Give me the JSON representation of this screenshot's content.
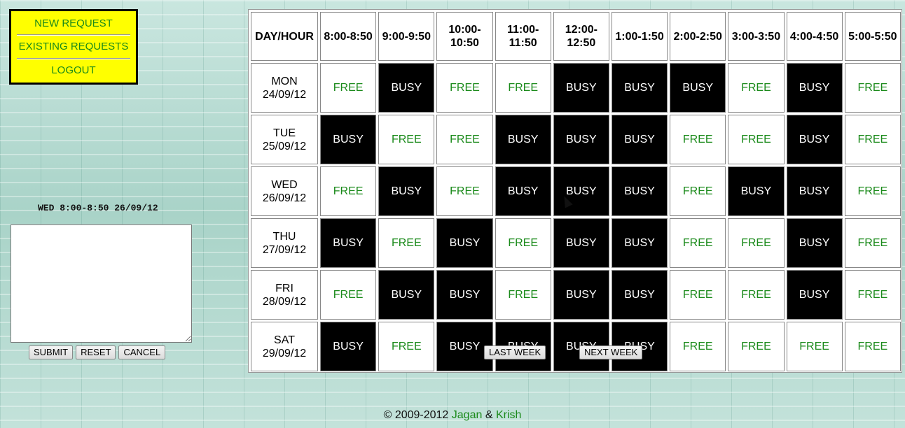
{
  "nav": {
    "items": [
      {
        "label": "NEW REQUEST"
      },
      {
        "label": "EXISTING REQUESTS"
      },
      {
        "label": "LOGOUT"
      }
    ]
  },
  "selection": {
    "label": "WED 8:00-8:50 26/09/12",
    "comment_value": ""
  },
  "form": {
    "submit_label": "SUBMIT",
    "reset_label": "RESET",
    "cancel_label": "CANCEL"
  },
  "schedule": {
    "corner_header": "DAY/HOUR",
    "hours": [
      "8:00-8:50",
      "9:00-9:50",
      "10:00-10:50",
      "11:00-11:50",
      "12:00-12:50",
      "1:00-1:50",
      "2:00-2:50",
      "3:00-3:50",
      "4:00-4:50",
      "5:00-5:50"
    ],
    "days": [
      {
        "day": "MON",
        "date": "24/09/12",
        "slots": [
          "FREE",
          "BUSY",
          "FREE",
          "FREE",
          "BUSY",
          "BUSY",
          "BUSY",
          "FREE",
          "BUSY",
          "FREE"
        ]
      },
      {
        "day": "TUE",
        "date": "25/09/12",
        "slots": [
          "BUSY",
          "FREE",
          "FREE",
          "BUSY",
          "BUSY",
          "BUSY",
          "FREE",
          "FREE",
          "BUSY",
          "FREE"
        ]
      },
      {
        "day": "WED",
        "date": "26/09/12",
        "slots": [
          "FREE",
          "BUSY",
          "FREE",
          "BUSY",
          "BUSY",
          "BUSY",
          "FREE",
          "BUSY",
          "BUSY",
          "FREE"
        ]
      },
      {
        "day": "THU",
        "date": "27/09/12",
        "slots": [
          "BUSY",
          "FREE",
          "BUSY",
          "FREE",
          "BUSY",
          "BUSY",
          "FREE",
          "FREE",
          "BUSY",
          "FREE"
        ]
      },
      {
        "day": "FRI",
        "date": "28/09/12",
        "slots": [
          "FREE",
          "BUSY",
          "BUSY",
          "FREE",
          "BUSY",
          "BUSY",
          "FREE",
          "FREE",
          "BUSY",
          "FREE"
        ]
      },
      {
        "day": "SAT",
        "date": "29/09/12",
        "slots": [
          "BUSY",
          "FREE",
          "BUSY",
          "BUSY",
          "BUSY",
          "BUSY",
          "FREE",
          "FREE",
          "FREE",
          "FREE"
        ]
      }
    ],
    "last_week_label": "LAST WEEK",
    "next_week_label": "NEXT WEEK"
  },
  "footer": {
    "copyright": "© 2009-2012",
    "author1": "Jagan",
    "separator": "&",
    "author2": "Krish"
  },
  "colors": {
    "free_text": "#1a8a1a",
    "busy_bg": "#000000",
    "nav_bg": "#ffff00"
  }
}
